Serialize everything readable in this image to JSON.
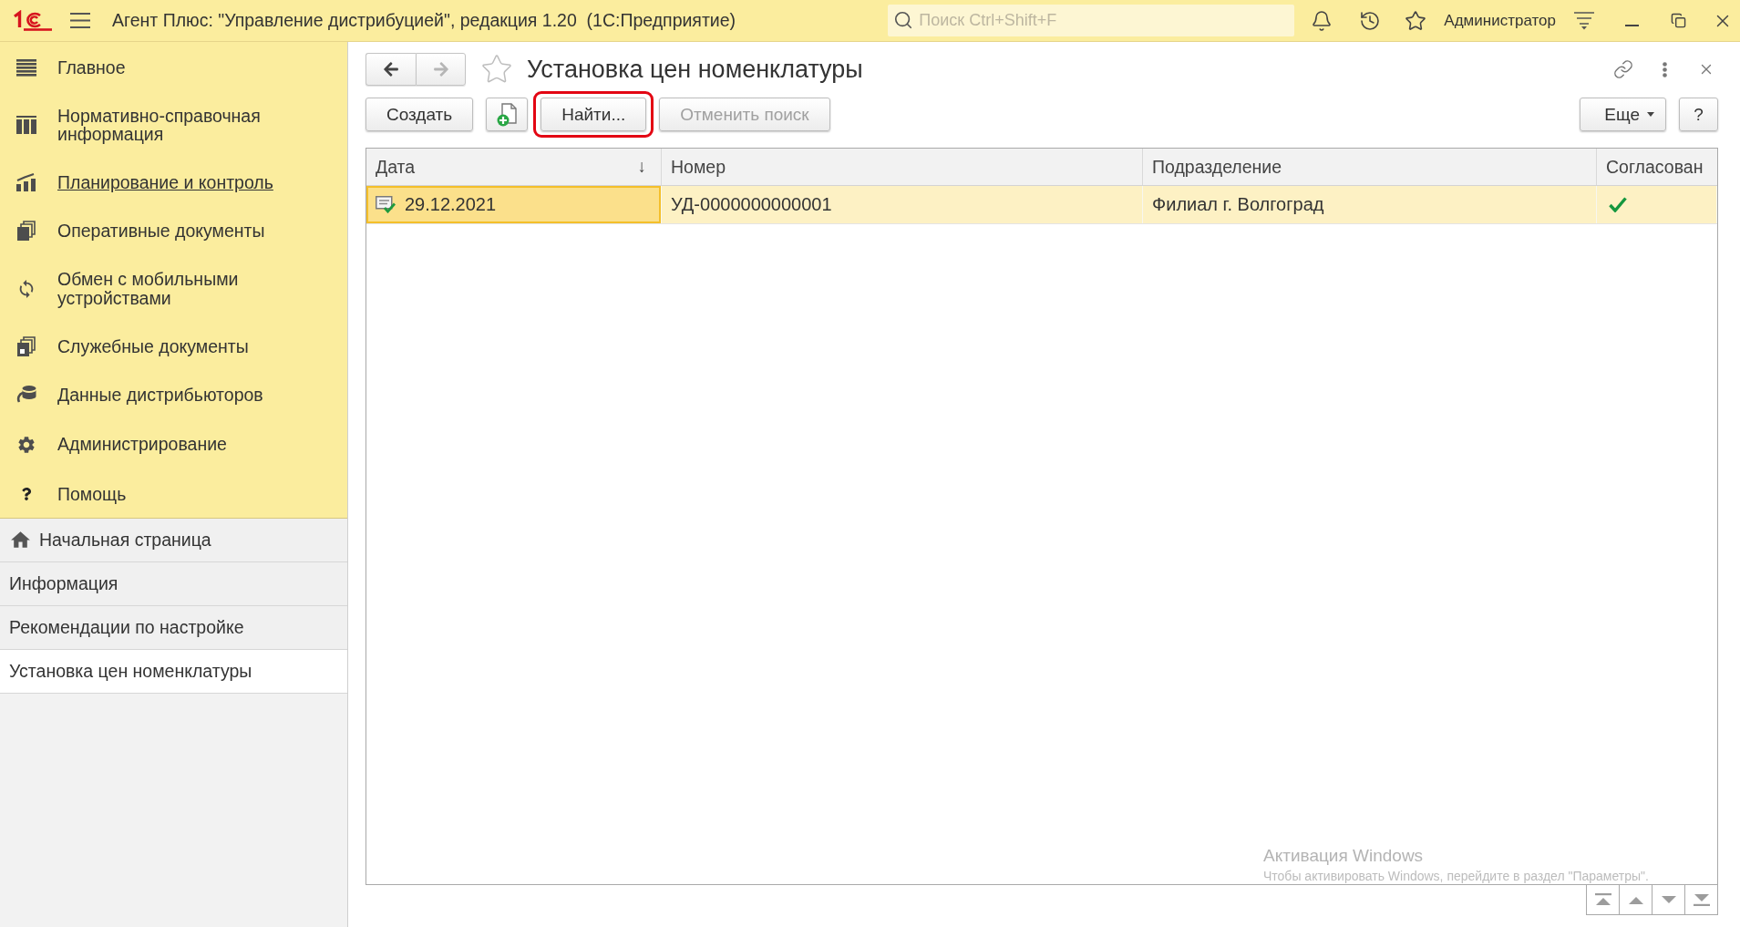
{
  "app_bar": {
    "title": "Агент Плюс: \"Управление дистрибуцией\", редакция 1.20  (1С:Предприятие)",
    "search": {
      "placeholder": "Поиск Ctrl+Shift+F"
    },
    "user": "Администратор"
  },
  "sections": [
    {
      "label": "Главное",
      "hovered": false
    },
    {
      "label": "Нормативно-справочная информация",
      "hovered": false
    },
    {
      "label": "Планирование и контроль",
      "hovered": true
    },
    {
      "label": "Оперативные документы",
      "hovered": false
    },
    {
      "label": "Обмен с мобильными устройствами",
      "hovered": false
    },
    {
      "label": "Служебные документы",
      "hovered": false
    },
    {
      "label": "Данные дистрибьюторов",
      "hovered": false
    },
    {
      "label": "Администрирование",
      "hovered": false
    },
    {
      "label": "Помощь",
      "hovered": false
    }
  ],
  "open_windows": [
    {
      "kind": "home",
      "label": "Начальная страница",
      "selected": false
    },
    {
      "kind": "window",
      "label": "Информация",
      "selected": false
    },
    {
      "kind": "window",
      "label": "Рекомендации по настройке",
      "selected": false
    },
    {
      "kind": "window",
      "label": "Установка цен номенклатуры",
      "selected": true
    }
  ],
  "form": {
    "title": "Установка цен номенклатуры",
    "favorite": false,
    "navigation": [
      {
        "kind": "back",
        "disabled": false
      },
      {
        "kind": "forward",
        "disabled": true
      }
    ],
    "toolbar": [
      {
        "kind": "text",
        "label": "Создать",
        "disabled": false,
        "highlighted": false
      },
      {
        "kind": "icon",
        "disabled": false,
        "highlighted": false
      },
      {
        "kind": "text",
        "label": "Найти...",
        "disabled": false,
        "highlighted": true
      },
      {
        "kind": "text",
        "label": "Отменить поиск",
        "disabled": true,
        "highlighted": false
      }
    ],
    "toolbar_right": [
      {
        "kind": "menu",
        "label": "Еще"
      },
      {
        "kind": "text",
        "label": "?"
      }
    ],
    "table": {
      "columns": [
        {
          "label": "Дата",
          "sort_mark": "↓"
        },
        {
          "label": "Номер"
        },
        {
          "label": "Подразделение"
        },
        {
          "label": "Согласован"
        }
      ],
      "rows": [
        {
          "selected": true,
          "posted": true,
          "approved": true,
          "cells": [
            {
              "text": "29.12.2021",
              "focused": true
            },
            {
              "text": "УД-0000000000001",
              "focused": false
            },
            {
              "text": "Филиал г. Волгоград",
              "focused": false
            }
          ]
        }
      ]
    }
  },
  "os_overlay": {
    "title": "Активация Windows",
    "text": "Чтобы активировать Windows, перейдите в раздел \"Параметры\"."
  }
}
